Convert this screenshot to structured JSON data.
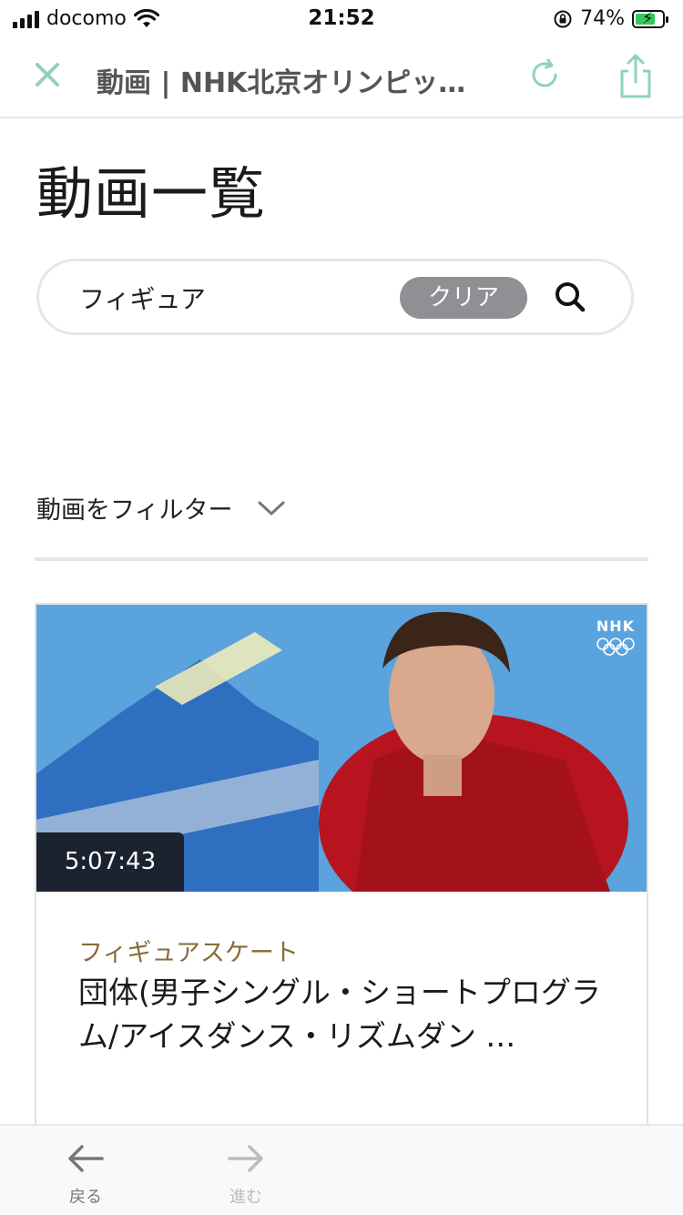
{
  "status_bar": {
    "carrier": "docomo",
    "time": "21:52",
    "battery_percent": "74%",
    "battery_level": 0.74
  },
  "browser": {
    "title": "動画 | NHK北京オリンピッ…",
    "accent_color": "#8fd3b6"
  },
  "page": {
    "heading": "動画一覧",
    "search": {
      "value": "フィギュア",
      "clear_label": "クリア"
    },
    "filter_label": "動画をフィルター"
  },
  "video_card": {
    "duration": "5:07:43",
    "logo_text": "NHK",
    "category": "フィギュアスケート",
    "title": "団体(男子シングル・ショートプログラム/アイスダンス・リズムダン …",
    "category_color": "#8a6a3a"
  },
  "toolbar": {
    "back_label": "戻る",
    "forward_label": "進む"
  }
}
